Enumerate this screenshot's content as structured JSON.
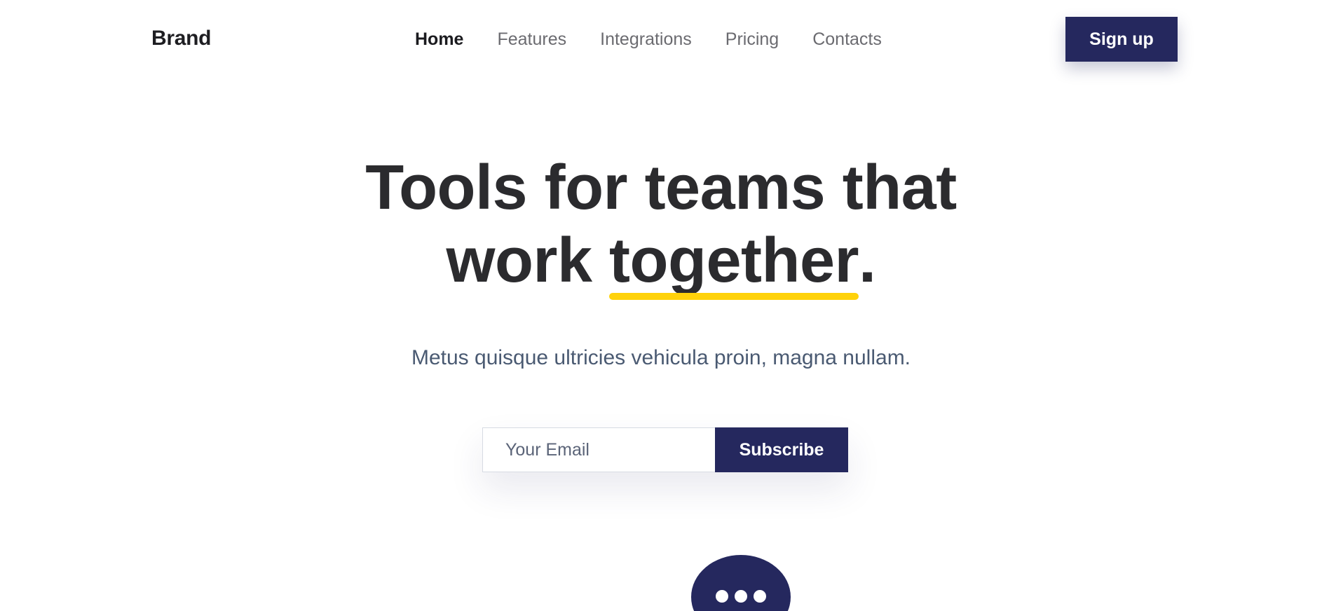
{
  "header": {
    "brand": "Brand",
    "nav": [
      {
        "label": "Home",
        "active": true
      },
      {
        "label": "Features",
        "active": false
      },
      {
        "label": "Integrations",
        "active": false
      },
      {
        "label": "Pricing",
        "active": false
      },
      {
        "label": "Contacts",
        "active": false
      }
    ],
    "signup_label": "Sign up"
  },
  "hero": {
    "title_line1": "Tools for teams that",
    "title_line2_prefix": "work ",
    "title_highlight": "together",
    "title_suffix": ".",
    "subtitle": "Metus quisque ultricies vehicula proin, magna nullam."
  },
  "subscribe": {
    "email_placeholder": "Your Email",
    "email_value": "",
    "button_label": "Subscribe"
  },
  "chat_widget": {
    "icon": "chat-dots-icon"
  },
  "colors": {
    "primary": "#25285e",
    "highlight": "#ffd20a",
    "text_dark": "#2b2b2e",
    "subtitle": "#4a5a72"
  }
}
